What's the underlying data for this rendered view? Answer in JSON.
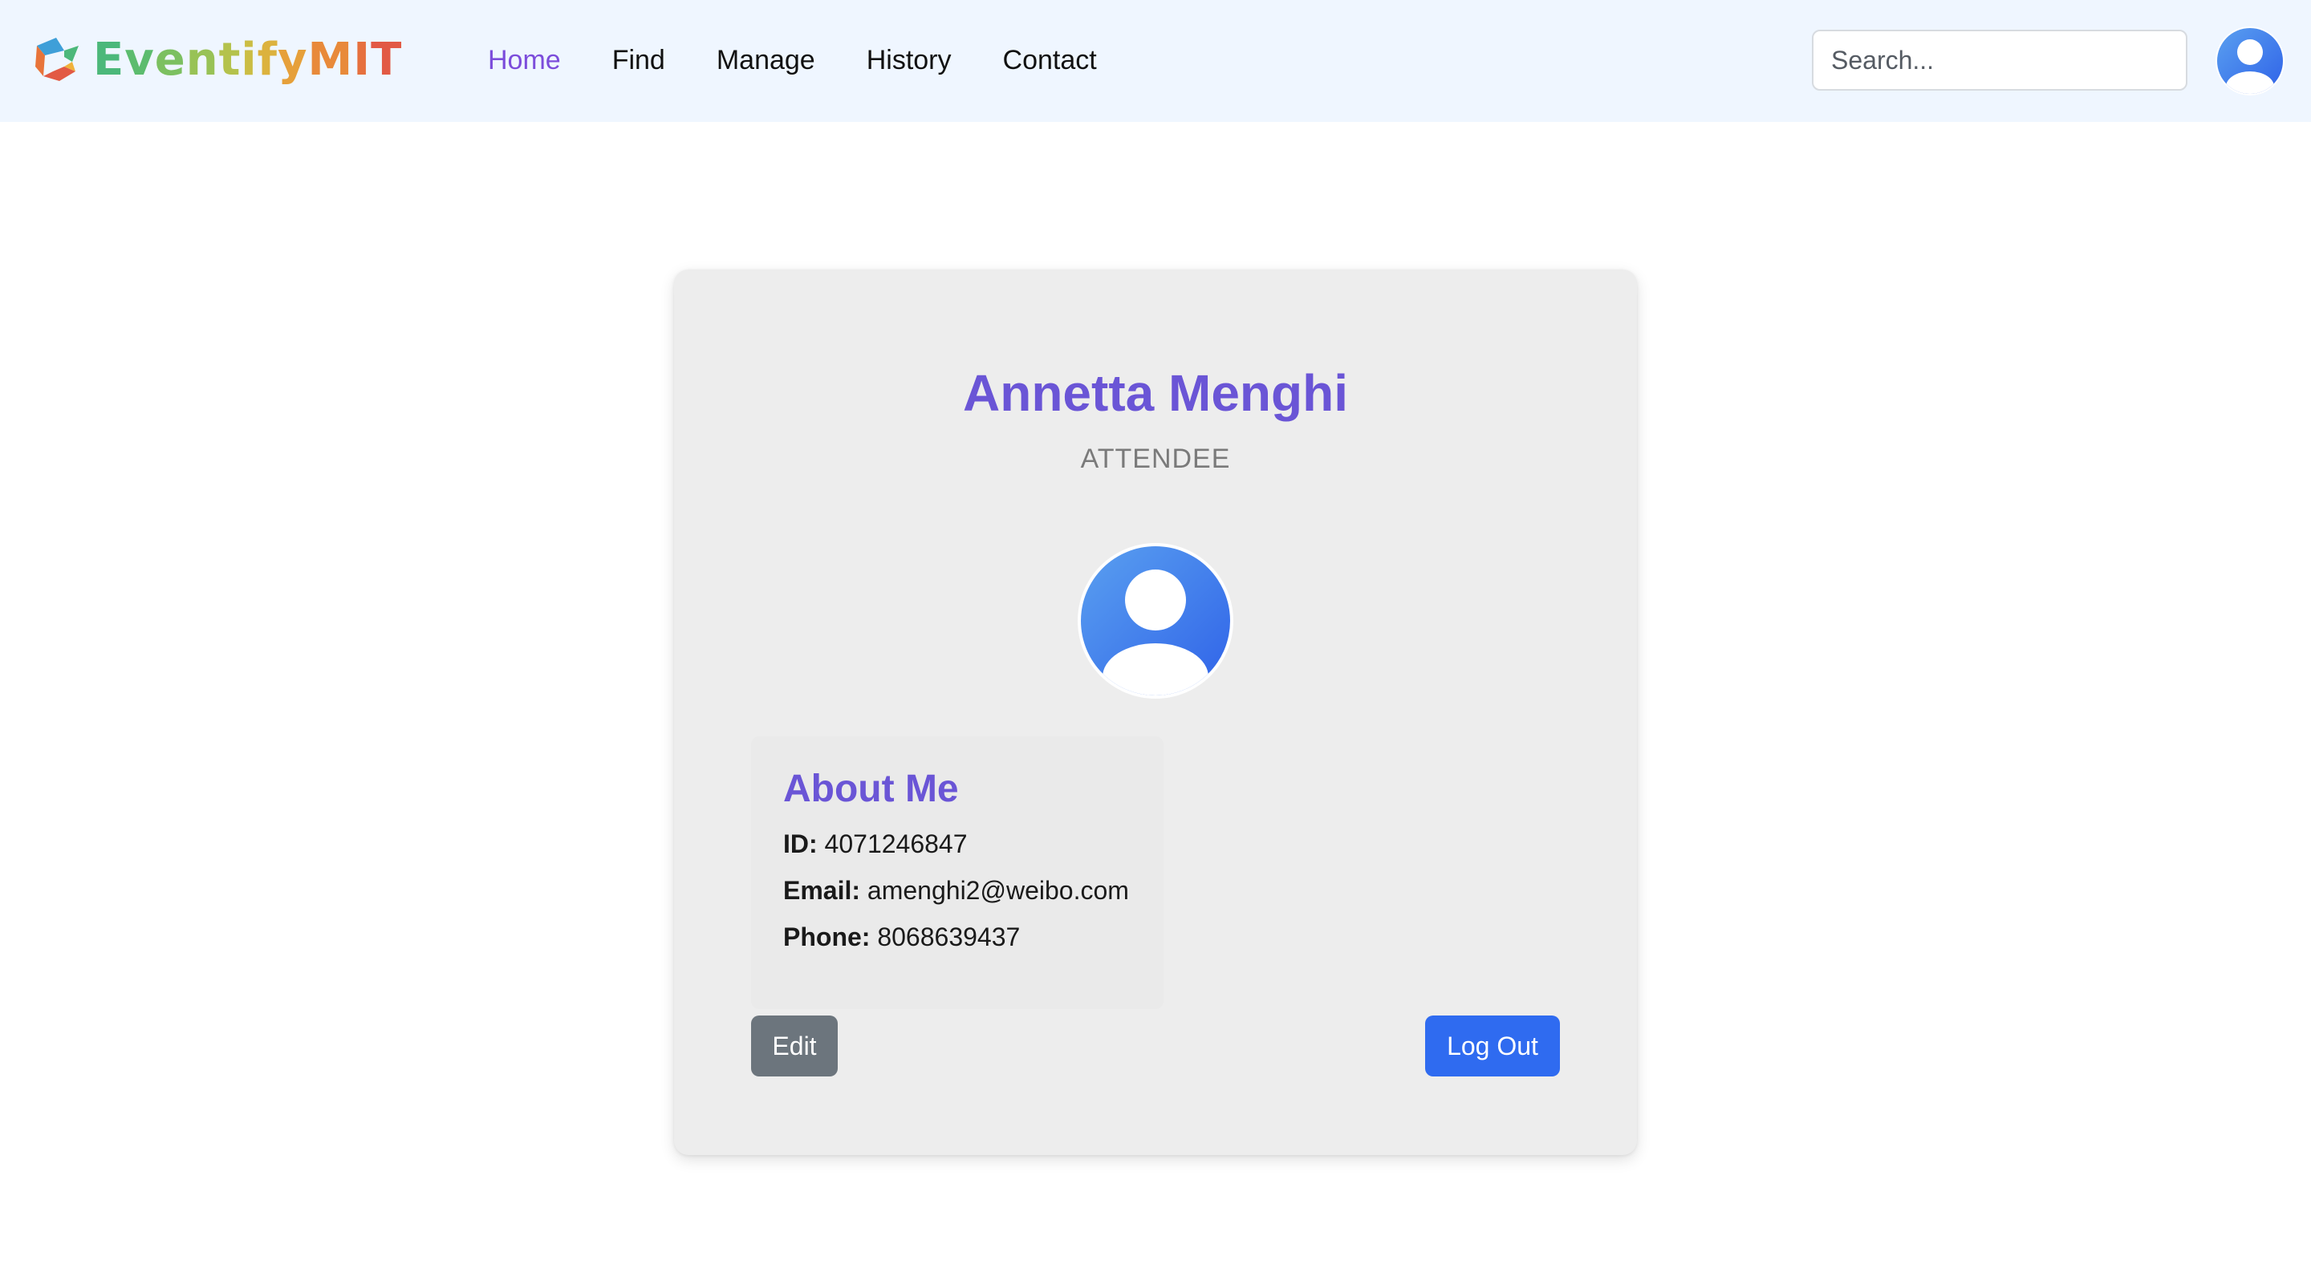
{
  "header": {
    "brand": {
      "letters": [
        {
          "ch": "E",
          "color": "#4cb87a"
        },
        {
          "ch": "v",
          "color": "#5cbc6e"
        },
        {
          "ch": "e",
          "color": "#7cc060"
        },
        {
          "ch": "n",
          "color": "#98c256"
        },
        {
          "ch": "t",
          "color": "#b4c24c"
        },
        {
          "ch": "i",
          "color": "#cbbd44"
        },
        {
          "ch": "f",
          "color": "#dcb23e"
        },
        {
          "ch": "y",
          "color": "#e6a03a"
        },
        {
          "ch": "M",
          "color": "#e88a3a"
        },
        {
          "ch": "I",
          "color": "#e6703e"
        },
        {
          "ch": "T",
          "color": "#e25a44"
        }
      ],
      "logo_icon": "eventify-logo-icon"
    },
    "nav": [
      {
        "label": "Home",
        "active": true
      },
      {
        "label": "Find",
        "active": false
      },
      {
        "label": "Manage",
        "active": false
      },
      {
        "label": "History",
        "active": false
      },
      {
        "label": "Contact",
        "active": false
      }
    ],
    "search": {
      "placeholder": "Search...",
      "value": ""
    },
    "avatar_icon": "user-avatar-icon"
  },
  "profile": {
    "name": "Annetta Menghi",
    "role": "ATTENDEE",
    "avatar_icon": "user-avatar-icon",
    "about": {
      "title": "About Me",
      "id_label": "ID:",
      "id_value": "4071246847",
      "email_label": "Email:",
      "email_value": "amenghi2@weibo.com",
      "phone_label": "Phone:",
      "phone_value": "8068639437"
    },
    "edit_label": "Edit",
    "logout_label": "Log Out"
  },
  "colors": {
    "accent": "#6a55d6",
    "nav_active": "#7c4ddb",
    "primary_button": "#2f6bf0",
    "secondary_button": "#6c757d",
    "navbar_bg": "#eff6ff",
    "card_bg": "#ededed"
  }
}
